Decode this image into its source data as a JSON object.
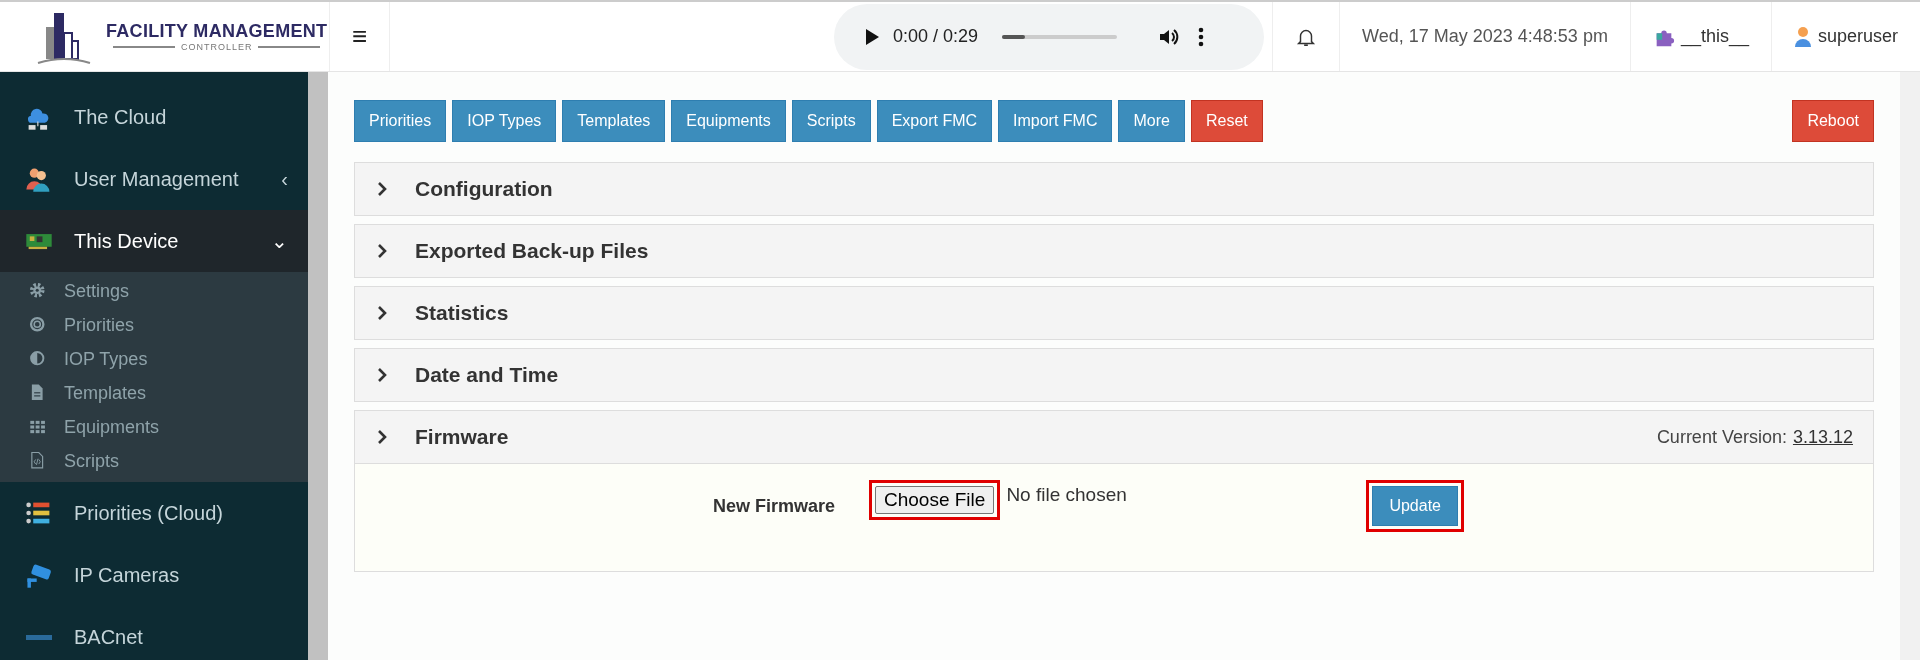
{
  "header": {
    "logo": {
      "title": "FACILITY MANAGEMENT",
      "subtitle": "CONTROLLER"
    },
    "menu_icon": "≡",
    "audio": {
      "time": "0:00 / 0:29",
      "level": 0.2
    },
    "datetime": "Wed, 17 May 2023 4:48:53 pm",
    "site": "__this__",
    "user": "superuser"
  },
  "sidebar": {
    "items": [
      {
        "label": "The Cloud",
        "expanded": false
      },
      {
        "label": "User Management",
        "expanded": false,
        "caret": "‹"
      },
      {
        "label": "This Device",
        "expanded": true,
        "caret": "⌄",
        "children": [
          {
            "label": "Settings"
          },
          {
            "label": "Priorities"
          },
          {
            "label": "IOP Types"
          },
          {
            "label": "Templates"
          },
          {
            "label": "Equipments"
          },
          {
            "label": "Scripts"
          }
        ]
      },
      {
        "label": "Priorities (Cloud)",
        "expanded": false
      },
      {
        "label": "IP Cameras",
        "expanded": false
      },
      {
        "label": "BACnet",
        "expanded": false
      }
    ]
  },
  "toolbar": {
    "buttons": [
      {
        "label": "Priorities",
        "kind": "primary"
      },
      {
        "label": "IOP Types",
        "kind": "primary"
      },
      {
        "label": "Templates",
        "kind": "primary"
      },
      {
        "label": "Equipments",
        "kind": "primary"
      },
      {
        "label": "Scripts",
        "kind": "primary"
      },
      {
        "label": "Export FMC",
        "kind": "primary"
      },
      {
        "label": "Import FMC",
        "kind": "primary"
      },
      {
        "label": "More",
        "kind": "primary"
      },
      {
        "label": "Reset",
        "kind": "danger"
      }
    ],
    "reboot": {
      "label": "Reboot",
      "kind": "danger"
    }
  },
  "panels": [
    {
      "title": "Configuration"
    },
    {
      "title": "Exported Back-up Files"
    },
    {
      "title": "Statistics"
    },
    {
      "title": "Date and Time"
    },
    {
      "title": "Firmware",
      "version_label": "Current Version:",
      "version": "3.13.12",
      "form": {
        "label": "New Firmware",
        "choose_button": {
          "label": "Choose File",
          "highlighted": true
        },
        "file_status": "No file chosen",
        "update_button": {
          "label": "Update",
          "highlighted": true
        }
      }
    }
  ]
}
